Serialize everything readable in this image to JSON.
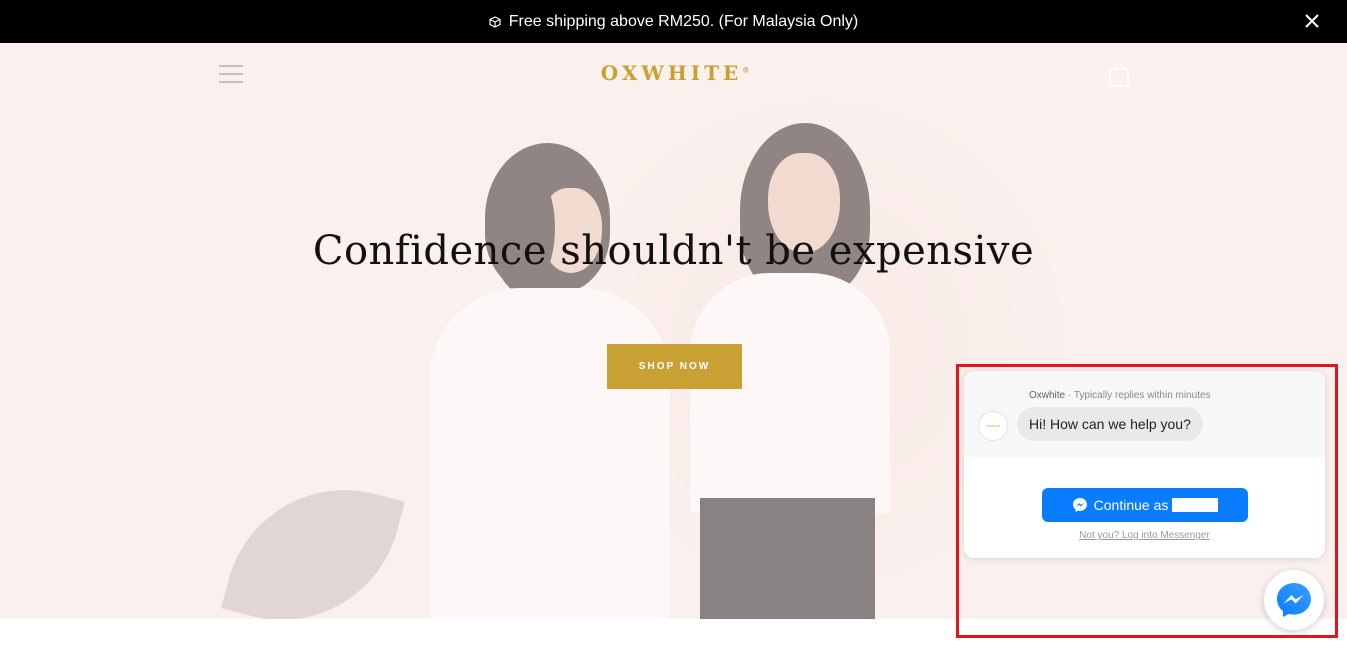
{
  "announcement": {
    "icon": "box-icon",
    "text": "Free shipping above RM250. (For Malaysia Only)",
    "close_icon": "close-icon"
  },
  "header": {
    "menu_icon": "hamburger-menu-icon",
    "logo": "OXWHITE",
    "logo_mark": "®",
    "cart_icon": "shopping-bag-icon"
  },
  "hero": {
    "headline": "Confidence shouldn't be expensive",
    "cta_label": "SHOP NOW"
  },
  "chat": {
    "page_name": "Oxwhite",
    "reply_time": " · Typically replies within minutes",
    "avatar_text": "OXWHITE",
    "greeting": "Hi! How can we help you?",
    "continue_label": "Continue as",
    "not_you_link": "Not you? Log into Messenger",
    "messenger_icon": "messenger-icon"
  },
  "colors": {
    "brand_gold": "#c9a034",
    "messenger_blue": "#0a7cff",
    "highlight_red": "#e3141e"
  }
}
